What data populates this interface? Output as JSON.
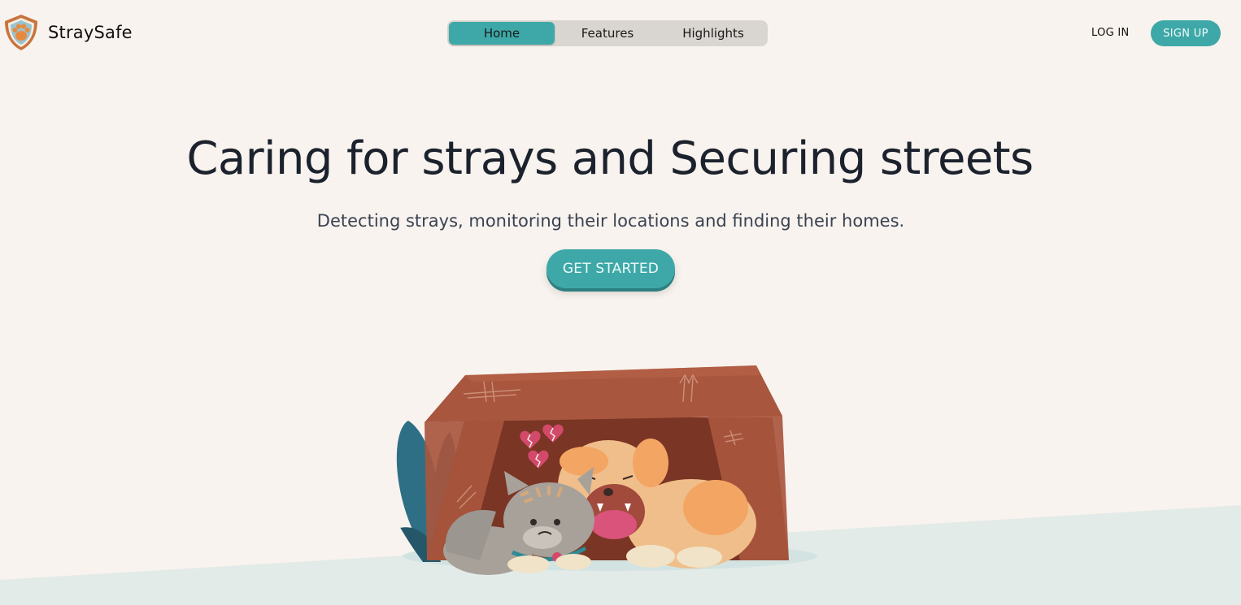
{
  "brand": {
    "name": "StraySafe",
    "logo_icon": "paw-shield-icon"
  },
  "nav": {
    "tabs": [
      {
        "label": "Home",
        "active": true
      },
      {
        "label": "Features",
        "active": false
      },
      {
        "label": "Highlights",
        "active": false
      }
    ]
  },
  "auth": {
    "login_label": "LOG IN",
    "signup_label": "SIGN UP"
  },
  "hero": {
    "title": "Caring for strays and Securing streets",
    "subtitle": "Detecting strays, monitoring their locations and finding their homes.",
    "cta_label": "GET STARTED",
    "illustration": "sad-cat-and-dog-in-cardboard-box",
    "heart_icons": "broken-heart-icon"
  },
  "colors": {
    "accent": "#3ea8a8",
    "background": "#f8f3ee",
    "ground": "#e3ebe8",
    "heading": "#1c222d",
    "box": "#a8563e"
  }
}
